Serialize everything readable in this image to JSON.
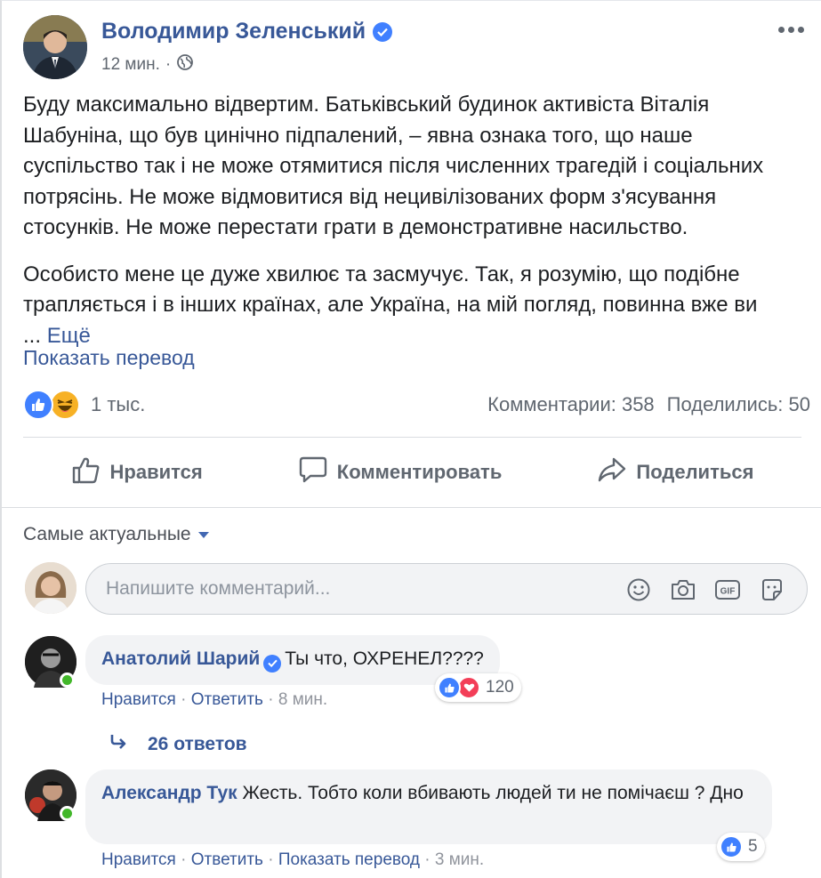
{
  "post": {
    "author": "Володимир Зеленський",
    "time": "12 мин.",
    "separator": "·",
    "paragraph1": "Буду максимально відвертим. Батьківський будинок активіста Віталія Шабуніна, що був цинічно підпалений, – явна ознака того, що наше суспільство так і не може отямитися після численних трагедій і соціальних потрясінь. Не може відмовитися від нецивілізованих форм з'ясування стосунків. Не може перестати грати в демонстративне насильство.",
    "paragraph2": "Особисто мене це дуже хвилює та засмучує. Так, я розумію, що подібне трапляється і в інших країнах, але Україна, на мій погляд, повинна вже ви",
    "ellipsis": "...",
    "see_more": "Ещё",
    "show_translation": "Показать перевод"
  },
  "reactions": {
    "count": "1 тыс.",
    "comments": "Комментарии: 358",
    "shares": "Поделились: 50"
  },
  "actions": {
    "like": "Нравится",
    "comment": "Комментировать",
    "share": "Поделиться"
  },
  "comments_section": {
    "sort_label": "Самые актуальные",
    "input_placeholder": "Напишите комментарий..."
  },
  "comments": [
    {
      "name": "Анатолий Шарий",
      "text": "Ты что, ОХРЕНЕЛ????",
      "like": "Нравится",
      "reply": "Ответить",
      "time": "8 мин.",
      "reaction_count": "120",
      "replies": "26 ответов"
    },
    {
      "name": "Александр Тук",
      "text": "Жесть. Тобто коли вбивають людей ти не помічаєш ? Дно",
      "like": "Нравится",
      "reply": "Ответить",
      "translate": "Показать перевод",
      "time": "3 мин.",
      "reaction_count": "5"
    }
  ],
  "colors": {
    "link": "#385898",
    "like_blue": "#4080ff",
    "online_green": "#42b72a"
  }
}
